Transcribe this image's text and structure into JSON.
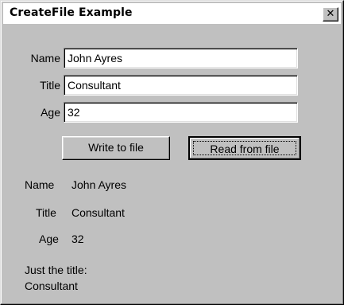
{
  "window": {
    "title": "CreateFile Example",
    "close_glyph": "✕"
  },
  "form": {
    "name_label": "Name",
    "name_value": "John Ayres",
    "title_label": "Title",
    "title_value": "Consultant",
    "age_label": "Age",
    "age_value": "32"
  },
  "buttons": {
    "write_label": "Write to file",
    "read_label": "Read from file"
  },
  "output": {
    "name_label": "Name",
    "name_value": "John Ayres",
    "title_label": "Title",
    "title_value": "Consultant",
    "age_label": "Age",
    "age_value": "32",
    "just_title_label": "Just the title:",
    "just_title_value": "Consultant"
  }
}
